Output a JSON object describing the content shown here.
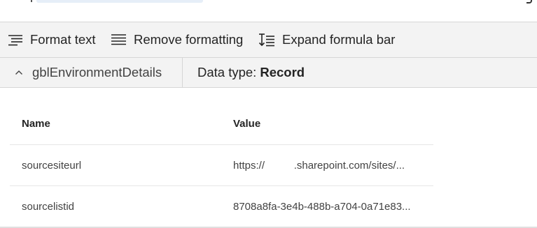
{
  "toolbar": {
    "format_text": "Format text",
    "remove_formatting": "Remove formatting",
    "expand_formula_bar": "Expand formula bar"
  },
  "variable_bar": {
    "variable_name": "gblEnvironmentDetails",
    "data_type_label": "Data type:",
    "data_type_value": "Record"
  },
  "table": {
    "columns": [
      "Name",
      "Value"
    ],
    "rows": [
      {
        "name": "sourcesiteurl",
        "value": "https://          .sharepoint.com/sites/..."
      },
      {
        "name": "sourcelistid",
        "value": "8708a8fa-3e4b-488b-a704-0a71e83..."
      }
    ]
  }
}
